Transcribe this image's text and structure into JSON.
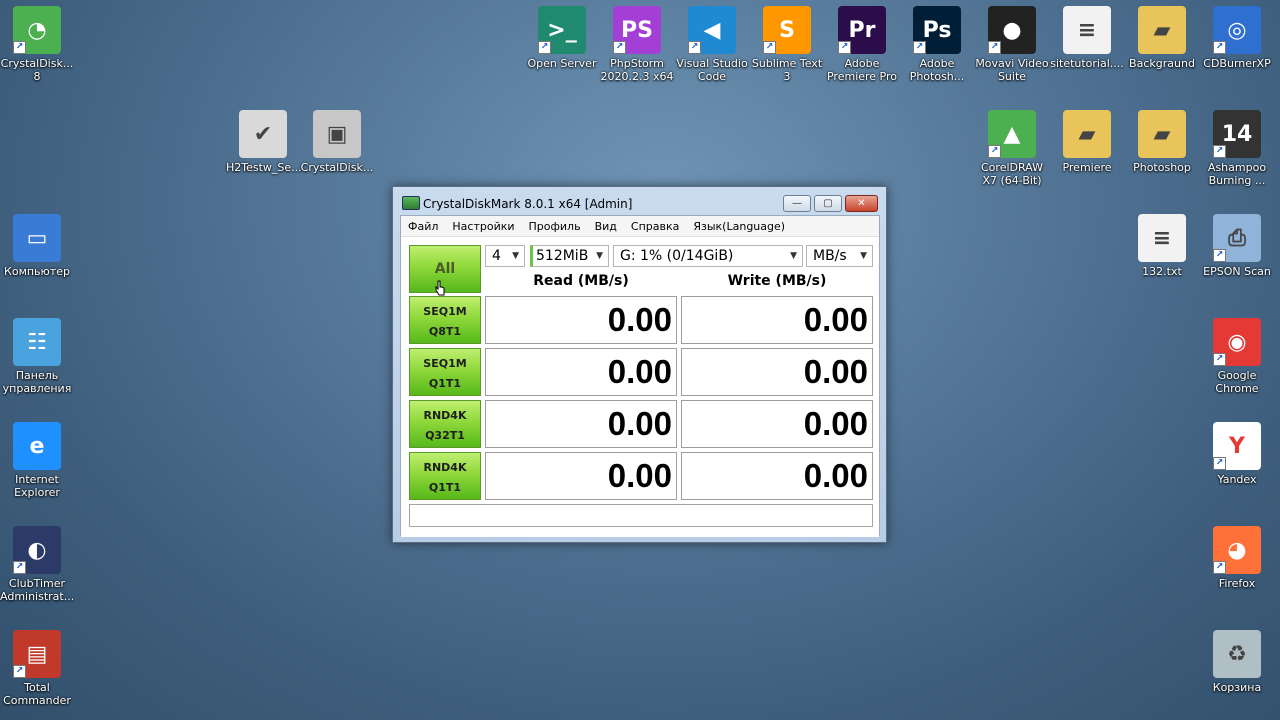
{
  "desktop": {
    "icons": [
      {
        "label": "CrystalDisk... 8",
        "icon": "crystaldisk-icon",
        "bg": "#4caf50",
        "glyph": "◔",
        "shortcut": true
      },
      {
        "label": "H2Testw_Se...",
        "icon": "h2testw-icon",
        "bg": "#d9d9d9",
        "glyph": "✔",
        "shortcut": false
      },
      {
        "label": "CrystalDisk...",
        "icon": "crystaldisk-installer-icon",
        "bg": "#c7c7c7",
        "glyph": "▣",
        "shortcut": false
      },
      {
        "label": "Компьютер",
        "icon": "computer-icon",
        "bg": "#3a7bd5",
        "glyph": "▭",
        "shortcut": false
      },
      {
        "label": "Панель управления",
        "icon": "control-panel-icon",
        "bg": "#4aa3df",
        "glyph": "☷",
        "shortcut": false
      },
      {
        "label": "Internet Explorer",
        "icon": "internet-explorer-icon",
        "bg": "#1e90ff",
        "glyph": "e",
        "shortcut": false
      },
      {
        "label": "ClubTimer Administrat...",
        "icon": "clubtimer-icon",
        "bg": "#2b3a67",
        "glyph": "◐",
        "shortcut": true
      },
      {
        "label": "Total Commander",
        "icon": "total-commander-icon",
        "bg": "#c0392b",
        "glyph": "▤",
        "shortcut": true
      },
      {
        "label": "Open Server",
        "icon": "open-server-icon",
        "bg": "#1f8a70",
        "glyph": ">_",
        "shortcut": true
      },
      {
        "label": "PhpStorm 2020.2.3 x64",
        "icon": "phpstorm-icon",
        "bg": "#a43fd6",
        "glyph": "PS",
        "shortcut": true
      },
      {
        "label": "Visual Studio Code",
        "icon": "vscode-icon",
        "bg": "#1f8ad2",
        "glyph": "◀",
        "shortcut": true
      },
      {
        "label": "Sublime Text 3",
        "icon": "sublime-icon",
        "bg": "#ff9800",
        "glyph": "S",
        "shortcut": true
      },
      {
        "label": "Adobe Premiere Pro",
        "icon": "premiere-icon",
        "bg": "#2a0d4a",
        "glyph": "Pr",
        "shortcut": true
      },
      {
        "label": "Adobe Photosh...",
        "icon": "photoshop-icon",
        "bg": "#001e36",
        "glyph": "Ps",
        "shortcut": true
      },
      {
        "label": "Movavi Video Suite",
        "icon": "movavi-icon",
        "bg": "#222",
        "glyph": "●",
        "shortcut": true
      },
      {
        "label": "sitetutorial....",
        "icon": "text-file-icon",
        "bg": "#f2f2f2",
        "glyph": "≡",
        "shortcut": false
      },
      {
        "label": "Backgraund",
        "icon": "folder-icon",
        "bg": "#e8c45a",
        "glyph": "▰",
        "shortcut": false
      },
      {
        "label": "CDBurnerXP",
        "icon": "cdburnerxp-icon",
        "bg": "#2f6fd0",
        "glyph": "◎",
        "shortcut": true
      },
      {
        "label": "CorelDRAW X7 (64-Bit)",
        "icon": "coreldraw-icon",
        "bg": "#4caf50",
        "glyph": "▲",
        "shortcut": true
      },
      {
        "label": "Premiere",
        "icon": "folder-premiere-icon",
        "bg": "#e8c45a",
        "glyph": "▰",
        "shortcut": false
      },
      {
        "label": "Photoshop",
        "icon": "folder-photoshop-icon",
        "bg": "#e8c45a",
        "glyph": "▰",
        "shortcut": false
      },
      {
        "label": "Ashampoo Burning ...",
        "icon": "ashampoo-icon",
        "bg": "#333",
        "glyph": "14",
        "shortcut": true
      },
      {
        "label": "132.txt",
        "icon": "text-file-132-icon",
        "bg": "#f2f2f2",
        "glyph": "≡",
        "shortcut": false
      },
      {
        "label": "EPSON Scan",
        "icon": "epson-scan-icon",
        "bg": "#8fb3d9",
        "glyph": "⎙",
        "shortcut": true
      },
      {
        "label": "Google Chrome",
        "icon": "chrome-icon",
        "bg": "#e53935",
        "glyph": "◉",
        "shortcut": true
      },
      {
        "label": "Yandex",
        "icon": "yandex-icon",
        "bg": "#ffffff",
        "glyph": "Y",
        "shortcut": true
      },
      {
        "label": "Firefox",
        "icon": "firefox-icon",
        "bg": "#ff7139",
        "glyph": "◕",
        "shortcut": true
      },
      {
        "label": "Корзина",
        "icon": "recycle-bin-icon",
        "bg": "#b0bec5",
        "glyph": "♻",
        "shortcut": false
      }
    ]
  },
  "window": {
    "title": "CrystalDiskMark 8.0.1 x64 [Admin]",
    "menu": [
      "Файл",
      "Настройки",
      "Профиль",
      "Вид",
      "Справка",
      "Язык(Language)"
    ],
    "all_label": "All",
    "count": "4",
    "size": "512MiB",
    "drive": "G: 1% (0/14GiB)",
    "unit": "MB/s",
    "read_header": "Read (MB/s)",
    "write_header": "Write (MB/s)",
    "tests": [
      {
        "line1": "SEQ1M",
        "line2": "Q8T1",
        "read": "0.00",
        "write": "0.00"
      },
      {
        "line1": "SEQ1M",
        "line2": "Q1T1",
        "read": "0.00",
        "write": "0.00"
      },
      {
        "line1": "RND4K",
        "line2": "Q32T1",
        "read": "0.00",
        "write": "0.00"
      },
      {
        "line1": "RND4K",
        "line2": "Q1T1",
        "read": "0.00",
        "write": "0.00"
      }
    ],
    "status_text": ""
  }
}
